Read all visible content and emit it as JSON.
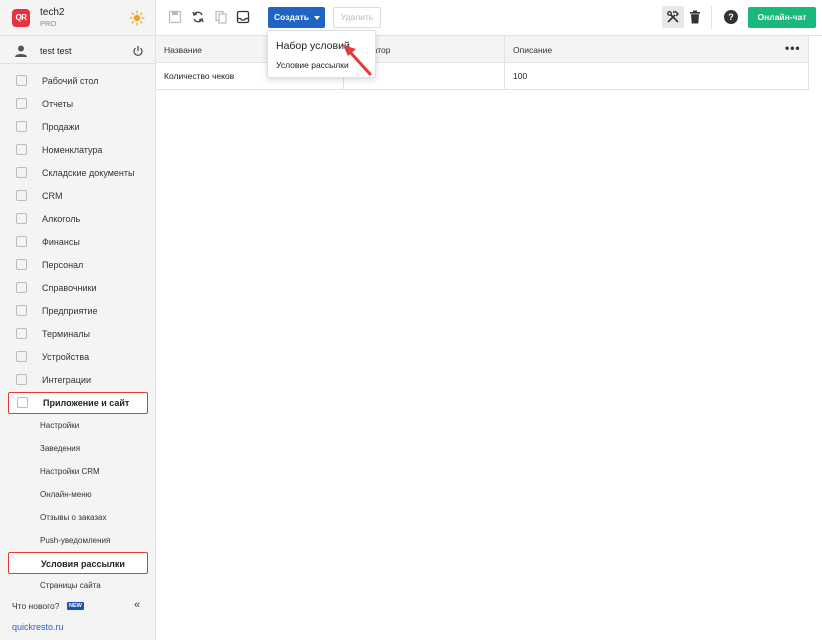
{
  "brand": {
    "name": "tech2",
    "plan": "PRO",
    "logo_text": "QR"
  },
  "user": {
    "name": "test test"
  },
  "nav": [
    {
      "label": "Рабочий стол",
      "icon": "dashboard-icon"
    },
    {
      "label": "Отчеты",
      "icon": "chart-icon"
    },
    {
      "label": "Продажи",
      "icon": "basket-icon"
    },
    {
      "label": "Номенклатура",
      "icon": "tag-icon"
    },
    {
      "label": "Складские документы",
      "icon": "box-icon"
    },
    {
      "label": "CRM",
      "icon": "crm-icon"
    },
    {
      "label": "Алкоголь",
      "icon": "glass-icon"
    },
    {
      "label": "Финансы",
      "icon": "wallet-icon"
    },
    {
      "label": "Персонал",
      "icon": "people-icon"
    },
    {
      "label": "Справочники",
      "icon": "book-icon"
    },
    {
      "label": "Предприятие",
      "icon": "shop-icon"
    },
    {
      "label": "Терминалы",
      "icon": "terminal-icon"
    },
    {
      "label": "Устройства",
      "icon": "printer-icon"
    },
    {
      "label": "Интеграции",
      "icon": "link-icon"
    },
    {
      "label": "Приложение и сайт",
      "icon": "app-icon",
      "active": true
    }
  ],
  "subnav": [
    {
      "label": "Настройки"
    },
    {
      "label": "Заведения"
    },
    {
      "label": "Настройки CRM"
    },
    {
      "label": "Онлайн-меню"
    },
    {
      "label": "Отзывы о заказах"
    },
    {
      "label": "Push-уведомления"
    },
    {
      "label": "Условия рассылки",
      "active": true
    },
    {
      "label": "Страницы сайта"
    }
  ],
  "footer": {
    "whats_new": "Что нового?",
    "new_badge": "NEW",
    "collapse": "«",
    "link": "quickresto.ru"
  },
  "toolbar": {
    "create_label": "Создать",
    "delete_label": "Удалить",
    "chat_label": "Онлайн-чат",
    "help_label": "?"
  },
  "table": {
    "headers": [
      "Название",
      "Оператор",
      "Описание"
    ],
    "rows": [
      {
        "name": "Количество чеков",
        "operator": "",
        "description": "100"
      }
    ]
  },
  "dropdown": {
    "items": [
      "Набор условий",
      "Условие рассылки"
    ]
  },
  "colors": {
    "primary": "#1f63c4",
    "chat": "#19b97e",
    "highlight": "#e53935",
    "logo": "#e8323c"
  }
}
